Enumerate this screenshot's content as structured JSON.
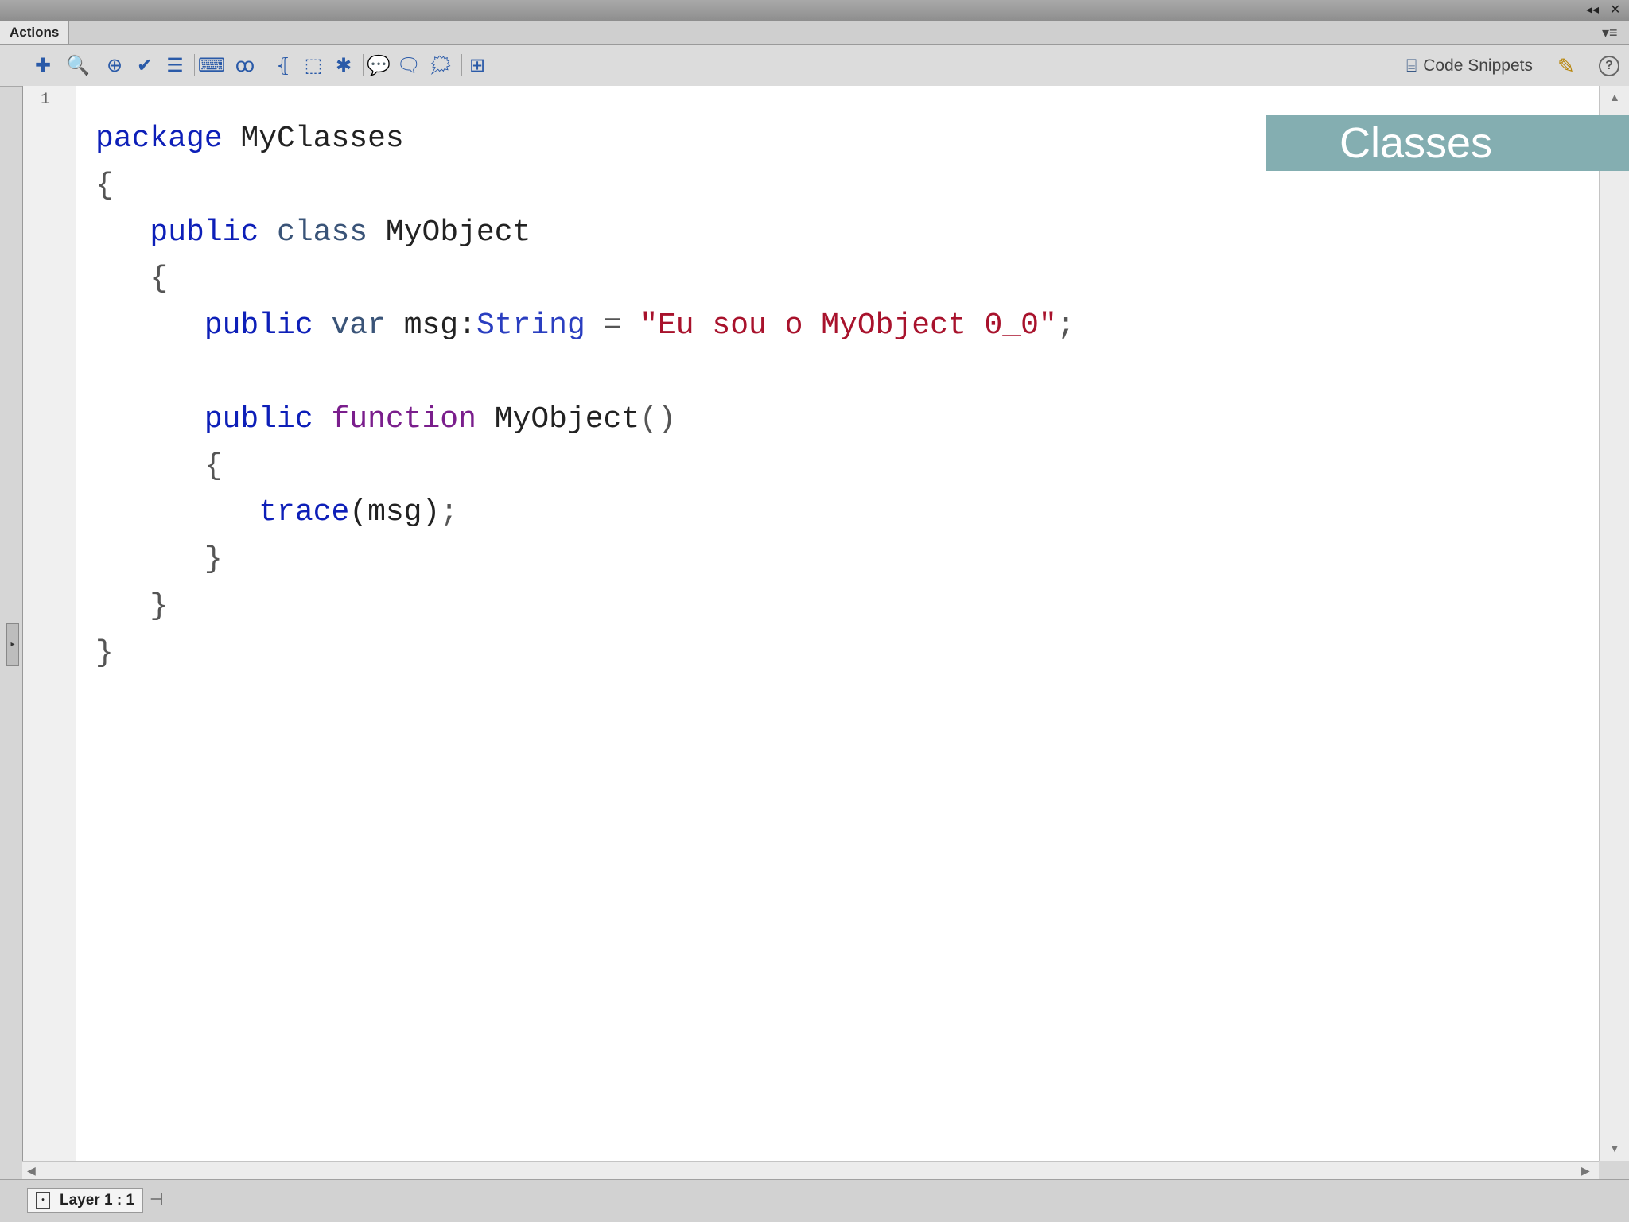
{
  "window": {
    "collapse_glyph": "◂◂",
    "close_glyph": "✕"
  },
  "panel": {
    "tab_label": "Actions",
    "menu_glyph": "▾≡"
  },
  "toolbar": {
    "icons": [
      {
        "name": "add-statement-icon",
        "glyph": "✚"
      },
      {
        "name": "find-icon",
        "glyph": "🔍"
      },
      {
        "name": "insert-target-path-icon",
        "glyph": "⊕"
      },
      {
        "name": "check-syntax-icon",
        "glyph": "✔"
      },
      {
        "name": "auto-format-icon",
        "glyph": "☰"
      },
      {
        "name": "show-code-hint-icon",
        "glyph": "⌨"
      },
      {
        "name": "debug-options-icon",
        "glyph": "ꝏ"
      },
      {
        "name": "collapse-between-braces-icon",
        "glyph": "⦃"
      },
      {
        "name": "collapse-selection-icon",
        "glyph": "⬚"
      },
      {
        "name": "expand-all-icon",
        "glyph": "✱"
      },
      {
        "name": "apply-block-comment-icon",
        "glyph": "💬"
      },
      {
        "name": "apply-line-comment-icon",
        "glyph": "🗨"
      },
      {
        "name": "remove-comment-icon",
        "glyph": "🗯"
      },
      {
        "name": "show-hide-toolbox-icon",
        "glyph": "⊞"
      }
    ],
    "code_snippets_label": "Code Snippets",
    "code_snippets_icon": "snippets-icon",
    "wand_icon": "wand-icon",
    "help_label": "?"
  },
  "editor": {
    "line_number": "1",
    "code": {
      "l1_kw": "package",
      "l1_name": "MyClasses",
      "l2_brace": "{",
      "l3_kw1": "public",
      "l3_kw2": "class",
      "l3_name": "MyObject",
      "l4_brace": "{",
      "l5_kw1": "public",
      "l5_kw2": "var",
      "l5_ident": "msg",
      "l5_colon": ":",
      "l5_type": "String",
      "l5_eq": "=",
      "l5_str": "\"Eu sou o MyObject 0_0\"",
      "l5_semi": ";",
      "l7_kw1": "public",
      "l7_kw2": "function",
      "l7_name": "MyObject",
      "l7_parens": "()",
      "l8_brace": "{",
      "l9_call": "trace",
      "l9_args": "(msg)",
      "l9_semi": ";",
      "l10_brace": "}",
      "l11_brace": "}",
      "l12_brace": "}"
    }
  },
  "overlay": {
    "label": "Classes"
  },
  "status": {
    "layer_label": "Layer 1 : 1"
  }
}
